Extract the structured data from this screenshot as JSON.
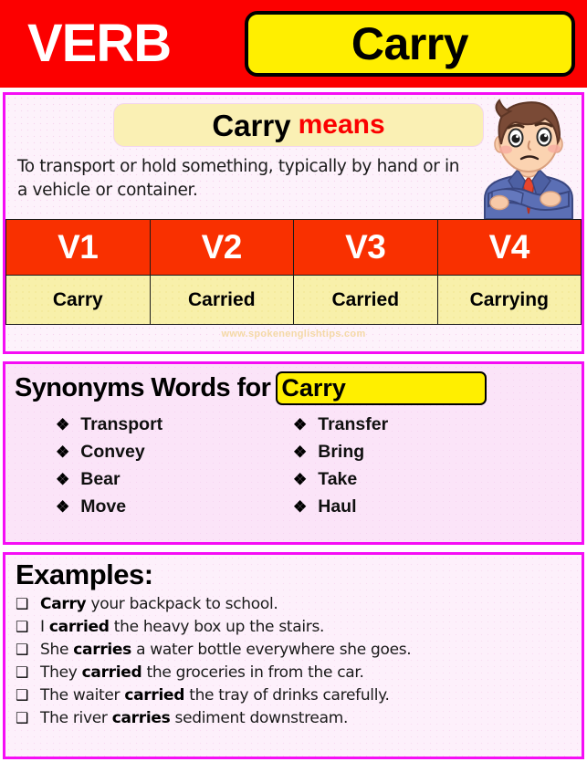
{
  "header": {
    "category_label": "VERB",
    "word": "Carry",
    "band_color": "#fc0000",
    "chip_color": "#ffef00"
  },
  "definition": {
    "pill_word": "Carry",
    "pill_suffix": "means",
    "pill_suffix_color": "#fb0000",
    "text": "To transport or hold something, typically by hand or in a vehicle or container.",
    "mascot": "confused-man-illustration"
  },
  "forms_table": {
    "headers": [
      "V1",
      "V2",
      "V3",
      "V4"
    ],
    "values": [
      "Carry",
      "Carried",
      "Carried",
      "Carrying"
    ],
    "header_color": "#f93000",
    "cell_color": "#f8f0aa"
  },
  "watermark": "www.spokenenglishtips.com",
  "synonyms": {
    "title": "Synonyms Words for",
    "chip_word": "Carry",
    "bullet_glyph": "❖",
    "left_column": [
      "Transport",
      "Convey",
      "Bear",
      "Move"
    ],
    "right_column": [
      "Transfer",
      "Bring",
      "Take",
      "Haul"
    ]
  },
  "examples": {
    "title": "Examples:",
    "bullet_glyph": "❑",
    "items": [
      {
        "pre": "",
        "bold": "Carry",
        "post": " your backpack to school."
      },
      {
        "pre": "I ",
        "bold": "carried",
        "post": " the heavy box up the stairs."
      },
      {
        "pre": "She ",
        "bold": "carries",
        "post": " a water bottle everywhere  she goes."
      },
      {
        "pre": "They ",
        "bold": "carried",
        "post": " the groceries  in from the car."
      },
      {
        "pre": "The waiter ",
        "bold": "carried",
        "post": " the tray of drinks carefully."
      },
      {
        "pre": "The river ",
        "bold": "carries",
        "post": " sediment downstream."
      }
    ]
  },
  "theme": {
    "panel_border": "#f50df5",
    "panel_bg_light": "#fdf0fb",
    "panel_bg_pink": "#fbe4f8"
  }
}
